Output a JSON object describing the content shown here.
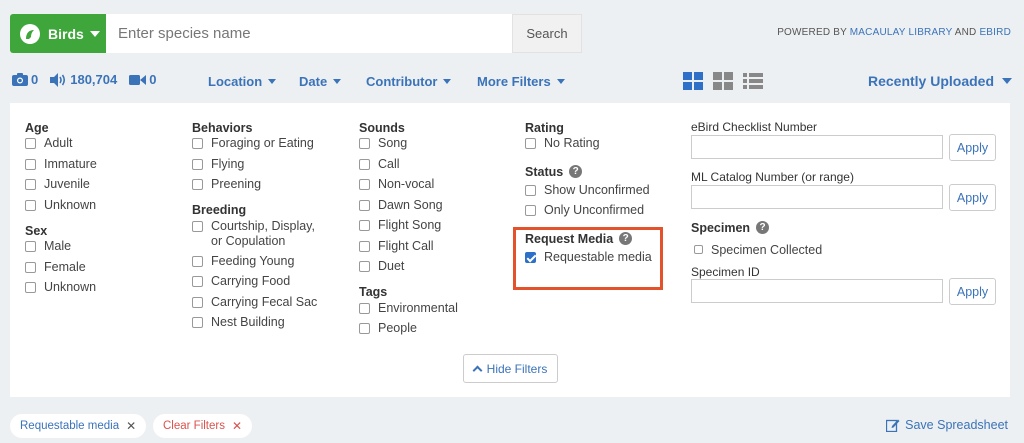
{
  "topbar": {
    "group_label": "Birds",
    "search_placeholder": "Enter species name",
    "search_button": "Search",
    "powered_prefix": "POWERED BY",
    "powered_link1": "MACAULAY LIBRARY",
    "powered_and": "AND",
    "powered_link2": "EBIRD"
  },
  "counts": {
    "photos": "0",
    "audio": "180,704",
    "video": "0"
  },
  "dropdowns": {
    "location": "Location",
    "date": "Date",
    "contributor": "Contributor",
    "more_filters": "More Filters"
  },
  "sort": {
    "label": "Recently Uploaded"
  },
  "filters": {
    "age": {
      "title": "Age",
      "options": [
        "Adult",
        "Immature",
        "Juvenile",
        "Unknown"
      ]
    },
    "sex": {
      "title": "Sex",
      "options": [
        "Male",
        "Female",
        "Unknown"
      ]
    },
    "behaviors": {
      "title": "Behaviors",
      "options": [
        "Foraging or Eating",
        "Flying",
        "Preening"
      ]
    },
    "breeding": {
      "title": "Breeding",
      "options": [
        "Courtship, Display,",
        "or Copulation",
        "Feeding Young",
        "Carrying Food",
        "Carrying Fecal Sac",
        "Nest Building"
      ]
    },
    "sounds": {
      "title": "Sounds",
      "options": [
        "Song",
        "Call",
        "Non-vocal",
        "Dawn Song",
        "Flight Song",
        "Flight Call",
        "Duet"
      ]
    },
    "tags": {
      "title": "Tags",
      "options": [
        "Environmental",
        "People"
      ]
    },
    "rating": {
      "title": "Rating",
      "options": [
        "No Rating"
      ]
    },
    "status": {
      "title": "Status",
      "options": [
        "Show Unconfirmed",
        "Only Unconfirmed"
      ]
    },
    "request_media": {
      "title": "Request Media",
      "options": [
        "Requestable media"
      ],
      "checked": true
    }
  },
  "right": {
    "checklist_label": "eBird Checklist Number",
    "catalog_label": "ML Catalog Number (or range)",
    "specimen_title": "Specimen",
    "specimen_collected": "Specimen Collected",
    "specimen_id_label": "Specimen ID",
    "apply": "Apply"
  },
  "hide_filters": "Hide Filters",
  "active_filters": {
    "chip1": "Requestable media",
    "clear": "Clear Filters"
  },
  "save_spreadsheet": "Save Spreadsheet",
  "colors": {
    "green": "#3ea63a",
    "blue": "#3b73b9",
    "red": "#d9534f",
    "highlight": "#e4522c"
  }
}
